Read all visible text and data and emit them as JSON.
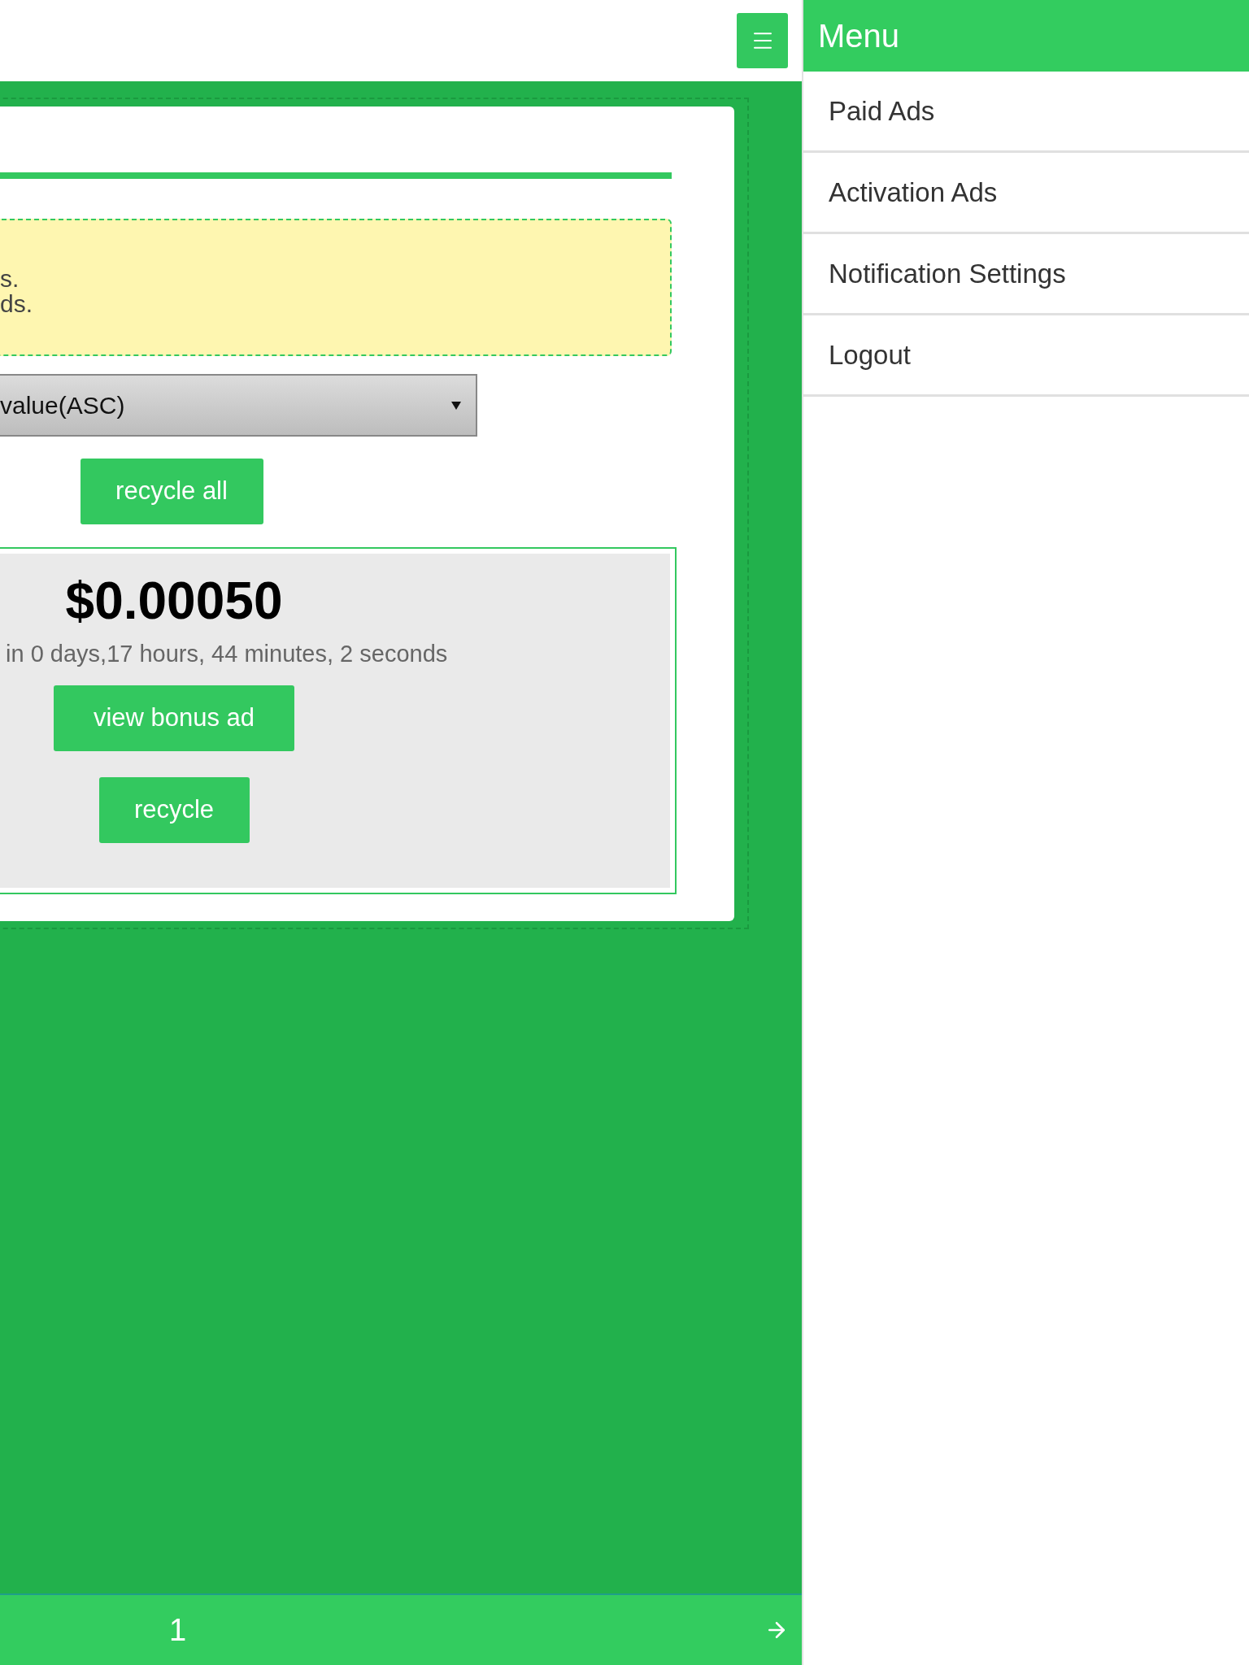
{
  "notice": {
    "lines": [
      "s.",
      "ds."
    ]
  },
  "sort_select": {
    "value": "value(ASC)"
  },
  "recycle_all_button": "recycle all",
  "ads": [
    {
      "price": "$0.00050",
      "countdown": "in 0 days,17 hours, 44 minutes, 2 seconds",
      "view_button": "view bonus ad",
      "recycle_button": "recycle"
    }
  ],
  "pagination": {
    "page": "1"
  },
  "sidebar": {
    "title": "Menu",
    "items": [
      "Paid Ads",
      "Activation Ads",
      "Notification Settings",
      "Logout"
    ]
  }
}
